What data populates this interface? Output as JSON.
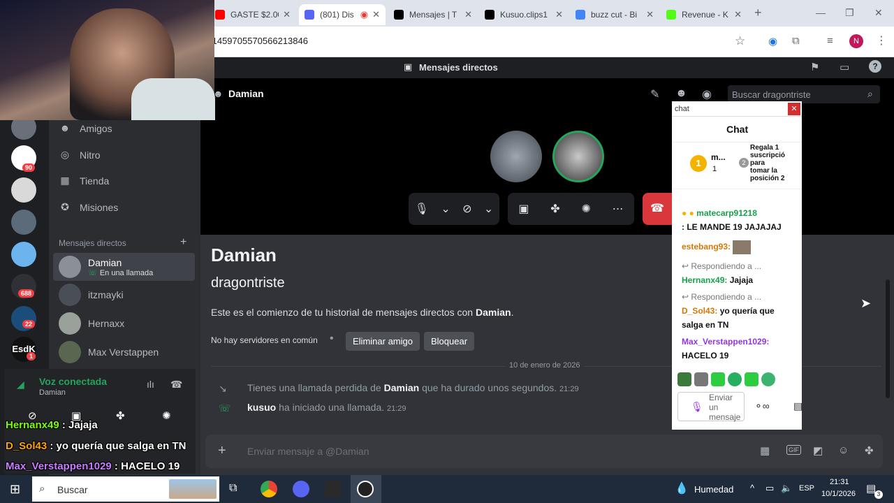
{
  "browser": {
    "tabs": [
      {
        "title": "GASTE $2.00",
        "color": "#ff0000"
      },
      {
        "title": "(801) Dis",
        "color": "#5865f2"
      },
      {
        "title": "Mensajes | T",
        "color": "#000000"
      },
      {
        "title": "Kusuo.clips1",
        "color": "#000000"
      },
      {
        "title": "buzz cut - Bi",
        "color": "#4285f4"
      },
      {
        "title": "Revenue - K",
        "color": "#53fc18"
      }
    ],
    "url": "/1459705570566213846",
    "profile_initial": "N"
  },
  "discord": {
    "top_label": "Mensajes directos",
    "channel_name": "Damian",
    "search_placeholder": "Buscar dragontriste",
    "nav": [
      "Amigos",
      "Nitro",
      "Tienda",
      "Misiones"
    ],
    "dm_header": "Mensajes directos",
    "dms": [
      {
        "name": "Damian",
        "status": "En una llamada"
      },
      {
        "name": "itzmayki"
      },
      {
        "name": "Hernaxx"
      },
      {
        "name": "Max Verstappen"
      }
    ],
    "server_badges": [
      "90",
      "688",
      "22",
      "1"
    ],
    "voice": {
      "status": "Voz conectada",
      "channel": "Damian"
    },
    "profile": {
      "title": "Damian",
      "subtitle": "dragontriste",
      "intro_prefix": "Este es el comienzo de tu historial de mensajes directos con ",
      "intro_name": "Damian",
      "intro_suffix": "."
    },
    "mutual": "No hay servidores en común",
    "remove_friend": "Eliminar amigo",
    "block": "Bloquear",
    "date_divider": "10 de enero de 2026",
    "events": [
      {
        "prefix": "Tienes una llamada perdida de ",
        "name": "Damian",
        "suffix": " que ha durado unos segundos.",
        "time": "21:29"
      },
      {
        "prefix": "",
        "name": "kusuo",
        "suffix": " ha iniciado una llamada.",
        "time": "21:29"
      }
    ],
    "input_placeholder": "Enviar mensaje a @Damian"
  },
  "overlay_chat": {
    "window_label": "chat",
    "title": "Chat",
    "top_user": "m...",
    "top_count": "1",
    "gift_text": "Regala 1 suscripción para tomar la posición 2",
    "messages": [
      {
        "user": "matecarp91218",
        "text": ": LE MANDE 19 JAJAJAJ",
        "color": "#16a34a"
      },
      {
        "user": "estebang93:",
        "text": "",
        "color": "#d97706"
      },
      {
        "reply": "Respondiendo a ...",
        "user": "Hernanx49:",
        "text": " Jajaja",
        "color": "#16a34a"
      },
      {
        "reply": "Respondiendo a ...",
        "user": "D_Sol43:",
        "text": " yo quería que salga en TN",
        "color": "#d97706"
      },
      {
        "user": "Max_Verstappen1029:",
        "text": " HACELO 19",
        "color": "#9333ea"
      }
    ],
    "send_placeholder": "Enviar un mensaje"
  },
  "stream_overlay": [
    {
      "user": "Hernanx49",
      "text": " : Jajaja",
      "color": "#7CFC00"
    },
    {
      "user": "D_Sol43",
      "text": " : yo quería que salga en TN",
      "color": "#FFA500"
    },
    {
      "user": "Max_Verstappen1029",
      "text": " : HACELO 19",
      "color": "#c77dff"
    }
  ],
  "taskbar": {
    "search": "Buscar",
    "weather": "Humedad",
    "lang": "ESP",
    "time": "21:31",
    "date": "10/1/2026",
    "notif_count": "3"
  }
}
